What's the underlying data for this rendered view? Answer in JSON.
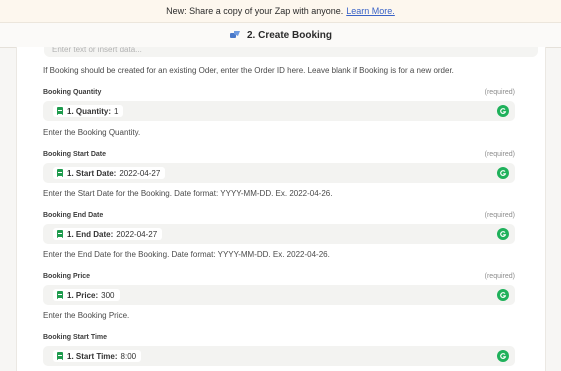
{
  "banner": {
    "text": "New: Share a copy of your Zap with anyone.",
    "link": "Learn More."
  },
  "header": {
    "title": "2. Create Booking"
  },
  "order_field": {
    "placeholder": "Enter text or insert data...",
    "help": "If Booking should be created for an existing Oder, enter the Order ID here. Leave blank if Booking is for a new order."
  },
  "fields": [
    {
      "label": "Booking Quantity",
      "required": "(required)",
      "pill_key": "1. Quantity:",
      "pill_value": "1",
      "help": "Enter the Booking Quantity."
    },
    {
      "label": "Booking Start Date",
      "required": "(required)",
      "pill_key": "1. Start Date:",
      "pill_value": "2022-04-27",
      "help": "Enter the Start Date for the Booking. Date format: YYYY-MM-DD. Ex. 2022-04-26."
    },
    {
      "label": "Booking End Date",
      "required": "(required)",
      "pill_key": "1. End Date:",
      "pill_value": "2022-04-27",
      "help": "Enter the End Date for the Booking. Date format: YYYY-MM-DD. Ex. 2022-04-26."
    },
    {
      "label": "Booking Price",
      "required": "(required)",
      "pill_key": "1. Price:",
      "pill_value": "300",
      "help": "Enter the Booking Price."
    },
    {
      "label": "Booking Start Time",
      "required": "",
      "pill_key": "1. Start Time:",
      "pill_value": "8:00",
      "help": ""
    }
  ]
}
